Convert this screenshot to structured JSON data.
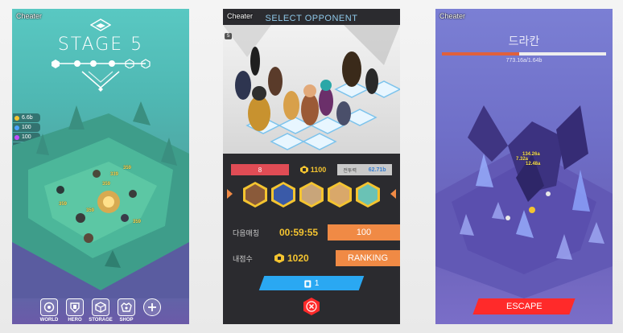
{
  "panel_world": {
    "cheater": "Cheater",
    "stage_title": "STAGE 5",
    "resources": [
      {
        "value": "6.6b",
        "color": "#f4c430"
      },
      {
        "value": "100",
        "color": "#4aa3ff"
      },
      {
        "value": "100",
        "color": "#c44cff"
      },
      {
        "value": "0",
        "color": "#c9c9c9"
      }
    ],
    "damage_numbers": [
      "359",
      "339",
      "359",
      "359",
      "359",
      "359"
    ],
    "nav": [
      {
        "label": "WORLD",
        "icon": "world-icon"
      },
      {
        "label": "HERO",
        "icon": "hero-icon"
      },
      {
        "label": "STORAGE",
        "icon": "storage-icon"
      },
      {
        "label": "SHOP",
        "icon": "shop-icon"
      },
      {
        "label": "",
        "icon": "plus-icon"
      }
    ]
  },
  "panel_opponent": {
    "cheater": "Cheater",
    "title": "SELECT OPPONENT",
    "level_badge": "5",
    "stats": {
      "rank_num": "8",
      "gold": "1100",
      "power_label": "전투력",
      "power_value": "62.71b"
    },
    "next_match_label": "다음매칭",
    "next_match_time": "00:59:55",
    "next_match_cost": "100",
    "my_score_label": "내점수",
    "my_score": "1020",
    "ranking_button": "RANKING",
    "ticket_count": "1",
    "colors": {
      "accent_blue": "#2aa8f2",
      "orange": "#f08a45",
      "red": "#e04c55"
    }
  },
  "panel_boss": {
    "cheater": "Cheater",
    "boss_name": "드라칸",
    "hp_text": "773.16a/1.64b",
    "hp_fraction": 0.47,
    "damage_numbers": [
      "134.26a",
      "7.32a",
      "12.48a"
    ],
    "escape_button": "ESCAPE"
  }
}
